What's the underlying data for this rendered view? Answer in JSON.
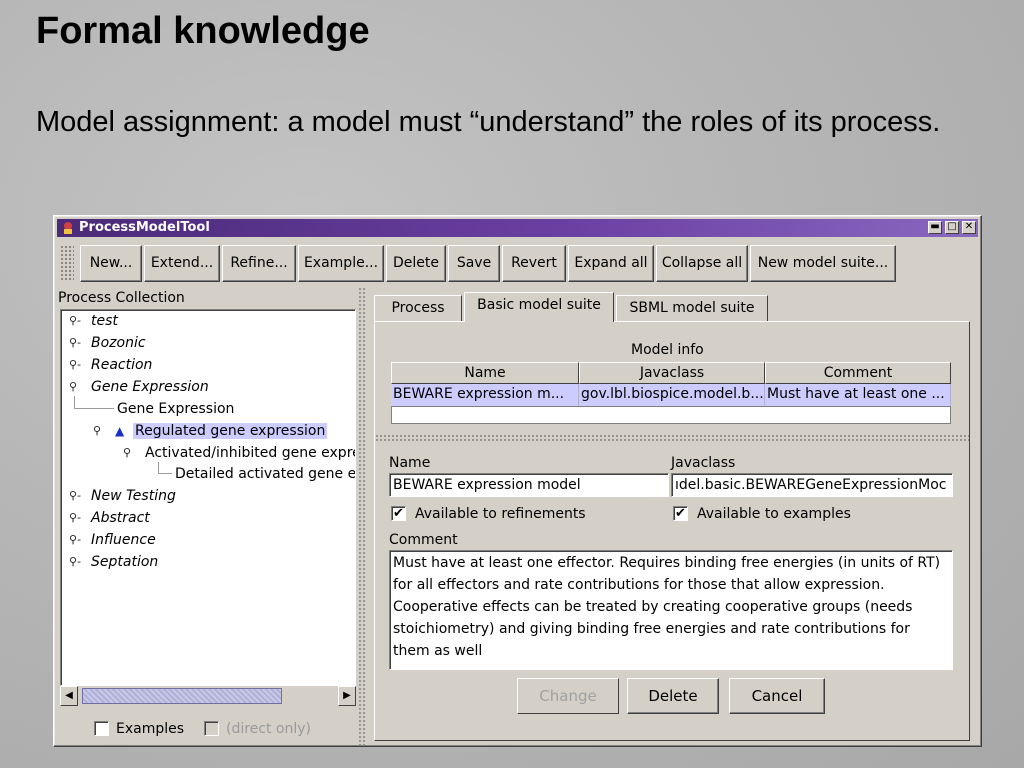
{
  "slide": {
    "title": "Formal knowledge",
    "body": "Model assignment: a model must “understand” the roles of its process."
  },
  "window": {
    "title": "ProcessModelTool",
    "controls": [
      "▬",
      "□",
      "✕"
    ]
  },
  "toolbar": {
    "buttons": [
      "New...",
      "Extend...",
      "Refine...",
      "Example...",
      "Delete",
      "Save",
      "Revert",
      "Expand all",
      "Collapse all",
      "New model suite..."
    ]
  },
  "left": {
    "label": "Process Collection",
    "tree": [
      {
        "label": "test",
        "italic": true
      },
      {
        "label": "Bozonic",
        "italic": true
      },
      {
        "label": "Reaction",
        "italic": true
      },
      {
        "label": "Gene Expression",
        "italic": true
      },
      {
        "label": "Gene Expression",
        "italic": false
      },
      {
        "label": "Regulated gene expression",
        "italic": false
      },
      {
        "label": "Activated/inhibited gene expre",
        "italic": false
      },
      {
        "label": "Detailed activated gene ex",
        "italic": false
      },
      {
        "label": "New Testing",
        "italic": true
      },
      {
        "label": "Abstract",
        "italic": true
      },
      {
        "label": "Influence",
        "italic": true
      },
      {
        "label": "Septation",
        "italic": true
      }
    ],
    "examples_label": "Examples",
    "direct_only_label": "(direct only)"
  },
  "tabs": [
    "Process",
    "Basic model suite",
    "SBML model suite"
  ],
  "model_info": {
    "title": "Model info",
    "columns": [
      "Name",
      "Javaclass",
      "Comment"
    ],
    "row": [
      "BEWARE expression m...",
      "gov.lbl.biospice.model.b...",
      "Must have at least one ..."
    ]
  },
  "detail": {
    "name_label": "Name",
    "name_value": "BEWARE expression model",
    "javaclass_label": "Javaclass",
    "javaclass_value": "ıdel.basic.BEWAREGeneExpressionMoc",
    "refinements_label": "Available to refinements",
    "examples_label": "Available to examples",
    "comment_label": "Comment",
    "comment_value": "Must have at least one effector.  Requires binding free energies (in units of RT) for all effectors and rate contributions for those that allow expression. Cooperative effects can be treated by creating cooperative groups (needs stoichiometry) and giving binding free energies and rate contributions for them as well"
  },
  "buttons": {
    "change": "Change",
    "delete": "Delete",
    "cancel": "Cancel"
  },
  "colors": {
    "selection": "#ccccff",
    "titlebar": "#4b2a78",
    "window_bg": "#d4d0c8"
  }
}
